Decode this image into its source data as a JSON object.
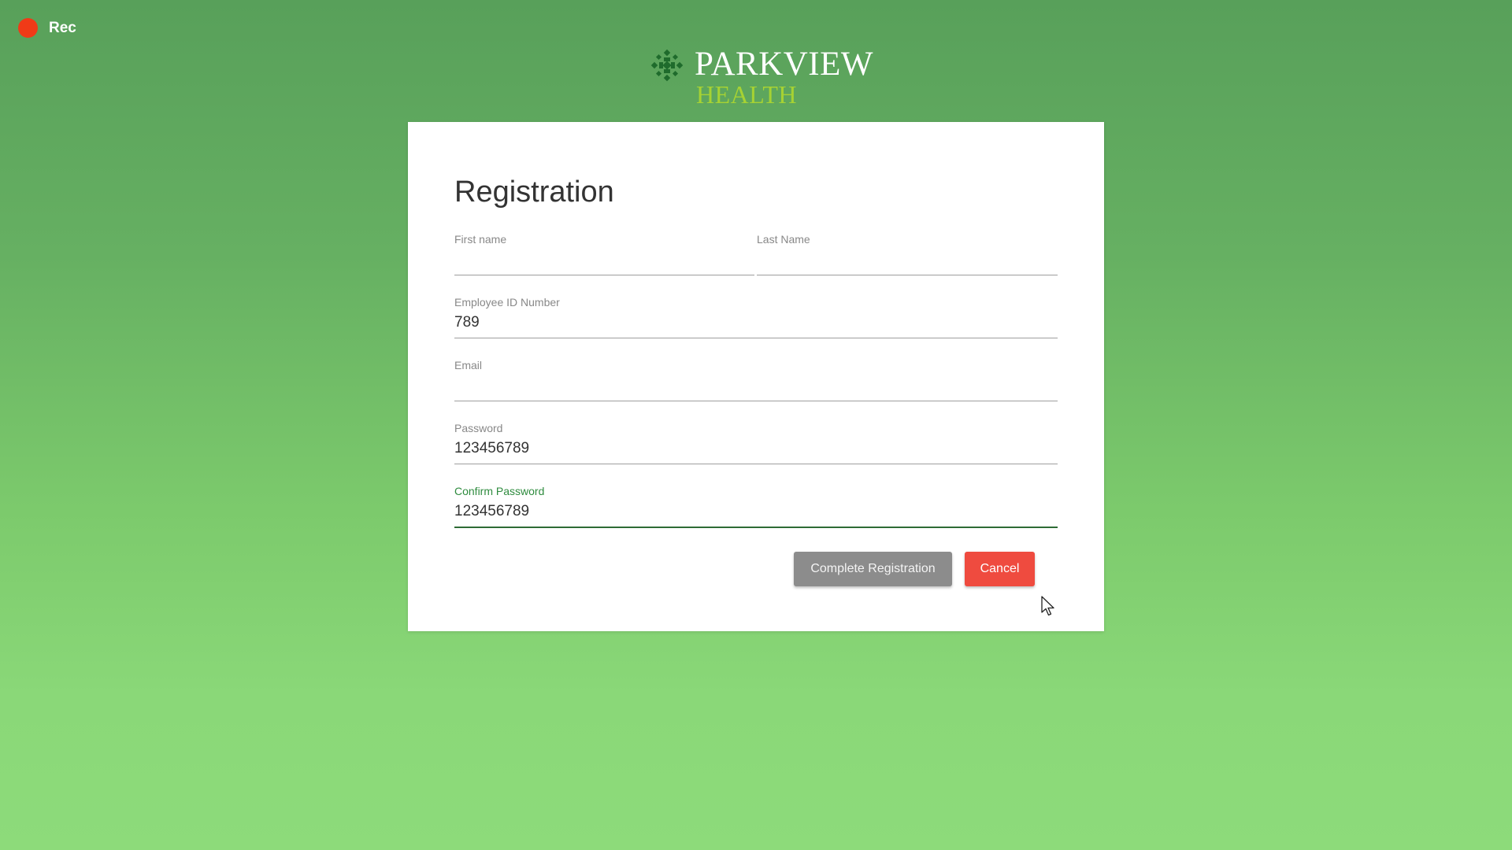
{
  "recording": {
    "label": "Rec",
    "dot_color": "#f03a17"
  },
  "logo": {
    "name": "PARKVIEW",
    "subtitle": "HEALTH",
    "icon": "parkview-leaf-logo-icon",
    "name_color": "#ffffff",
    "subtitle_color": "#a6d233",
    "mark_color": "#1f6b2c"
  },
  "form": {
    "title": "Registration",
    "fields": {
      "first_name": {
        "label": "First name",
        "value": ""
      },
      "last_name": {
        "label": "Last Name",
        "value": ""
      },
      "employee_id": {
        "label": "Employee ID Number",
        "value": "789"
      },
      "email": {
        "label": "Email",
        "value": ""
      },
      "password": {
        "label": "Password",
        "value": "123456789"
      },
      "confirm_password": {
        "label": "Confirm Password",
        "value": "123456789",
        "focused": true
      }
    },
    "buttons": {
      "complete": "Complete Registration",
      "cancel": "Cancel"
    }
  },
  "colors": {
    "focus_accent": "#2e8b3e",
    "cancel_button": "#ef4b3f",
    "complete_button": "#8c8c8c",
    "background_top": "#58a05a",
    "background_bottom": "#8ddb7a"
  },
  "cursor_icon": "arrow-cursor-icon"
}
